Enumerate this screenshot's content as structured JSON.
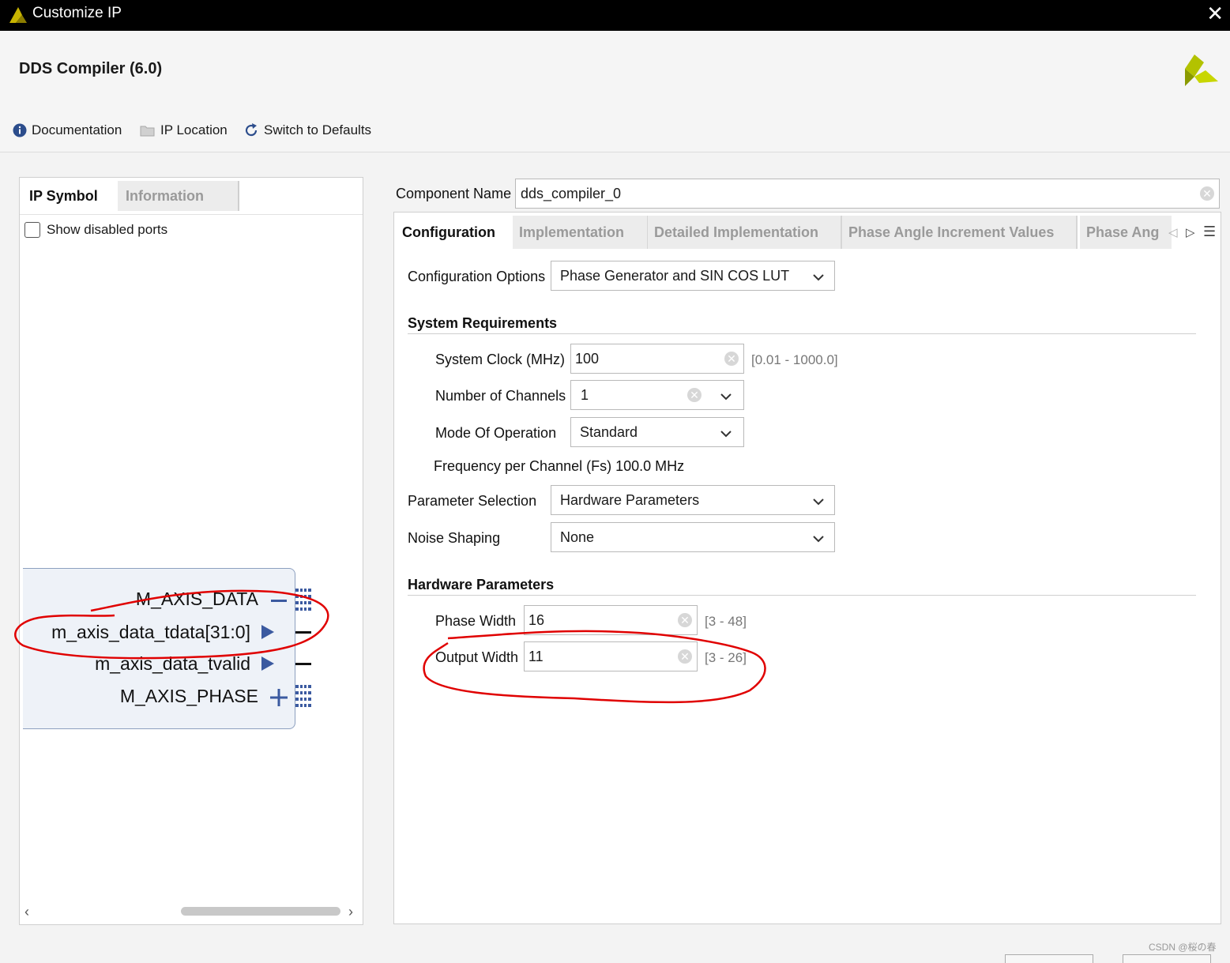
{
  "window": {
    "title": "Customize IP",
    "close_glyph": "✕"
  },
  "header": {
    "title": "DDS Compiler (6.0)"
  },
  "toolbar": {
    "documentation": "Documentation",
    "ip_location": "IP Location",
    "switch_defaults": "Switch to Defaults"
  },
  "left_panel": {
    "tabs": [
      "IP Symbol",
      "Information"
    ],
    "show_disabled_ports": "Show disabled ports",
    "ports": [
      "M_AXIS_DATA",
      "m_axis_data_tdata[31:0]",
      "m_axis_data_tvalid",
      "M_AXIS_PHASE"
    ]
  },
  "component": {
    "label": "Component Name",
    "value": "dds_compiler_0"
  },
  "config_tabs": [
    "Configuration",
    "Implementation",
    "Detailed Implementation",
    "Phase Angle Increment Values",
    "Phase Ang"
  ],
  "config": {
    "configuration_options": {
      "label": "Configuration Options",
      "value": "Phase Generator and SIN COS LUT"
    },
    "system_requirements": {
      "heading": "System Requirements",
      "system_clock": {
        "label": "System Clock (MHz)",
        "value": "100",
        "range": "[0.01 - 1000.0]"
      },
      "num_channels": {
        "label": "Number of Channels",
        "value": "1"
      },
      "mode": {
        "label": "Mode Of Operation",
        "value": "Standard"
      },
      "freq_per_channel": "Frequency per Channel (Fs) 100.0 MHz"
    },
    "parameter_selection": {
      "label": "Parameter Selection",
      "value": "Hardware Parameters"
    },
    "noise_shaping": {
      "label": "Noise Shaping",
      "value": "None"
    },
    "hardware_parameters": {
      "heading": "Hardware Parameters",
      "phase_width": {
        "label": "Phase Width",
        "value": "16",
        "range": "[3 - 48]"
      },
      "output_width": {
        "label": "Output Width",
        "value": "11",
        "range": "[3 - 26]"
      }
    }
  },
  "watermark": "CSDN @桜の春",
  "colors": {
    "titlebar": "#000000",
    "annotation": "#e00000",
    "port_arrow": "#3b5aa0",
    "logo": "#a8b400"
  }
}
